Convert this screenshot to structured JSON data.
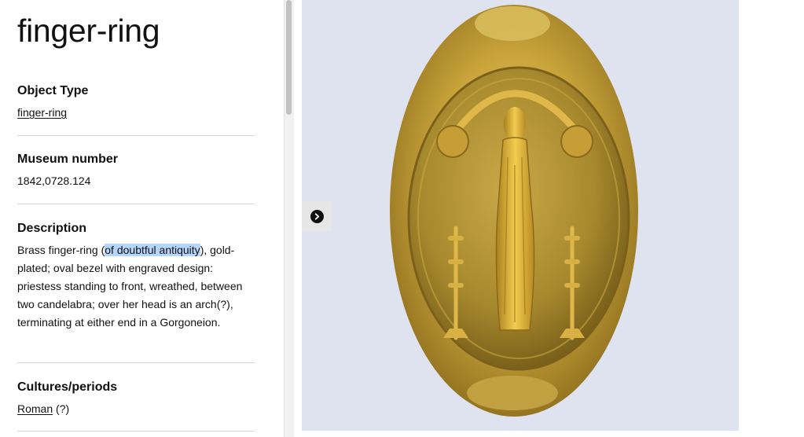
{
  "object": {
    "title": "finger-ring"
  },
  "fields": {
    "object_type": {
      "label": "Object Type",
      "value": "finger-ring"
    },
    "museum_number": {
      "label": "Museum number",
      "value": "1842,0728.124"
    },
    "description": {
      "label": "Description",
      "text_before": "Brass finger-ring (",
      "highlight": "of doubtful antiquity",
      "text_after": "), gold-plated; oval bezel with engraved design: priestess standing to front, wreathed, between two candelabra; over her head is an arch(?), terminating at either end in a Gorgoneion."
    },
    "cultures": {
      "label": "Cultures/periods",
      "value": "Roman",
      "qualifier": " (?)"
    }
  },
  "nav": {
    "icon": "chevron-right-icon"
  },
  "image": {
    "icon": "ring-photo"
  },
  "colors": {
    "highlight": "#b4d5fe",
    "image_bg": "#dfe3ef",
    "gold": "#c9a43a"
  }
}
